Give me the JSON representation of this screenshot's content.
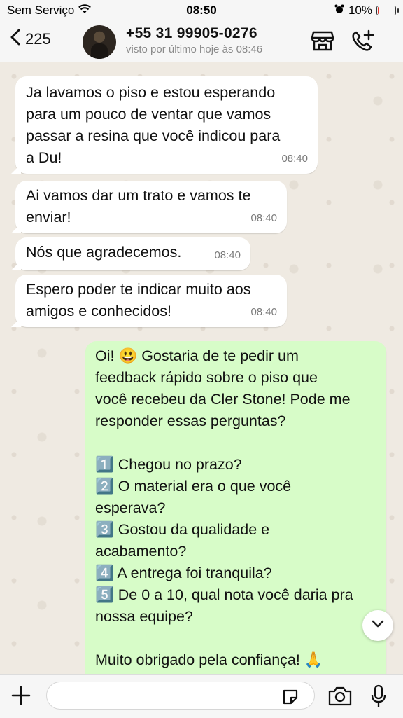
{
  "status_bar": {
    "carrier": "Sem Serviço",
    "time": "08:50",
    "battery": "10%",
    "battery_level": 0.1,
    "icons": [
      "wifi-icon",
      "alarm-icon",
      "battery-icon"
    ]
  },
  "header": {
    "back_count": "225",
    "contact_name": "+55 31 99905-0276",
    "last_seen": "visto por último hoje às 08:46",
    "icons": [
      "chevron-left-icon",
      "store-icon",
      "add-call-icon"
    ]
  },
  "messages": [
    {
      "direction": "in",
      "text": "Ja lavamos o piso e estou esperando\npara um pouco de ventar que vamos\npassar a resina que você indicou para\na Du!",
      "time": "08:40"
    },
    {
      "direction": "in",
      "text": "Ai vamos dar um trato e vamos te\nenviar!",
      "time": "08:40"
    },
    {
      "direction": "in",
      "text": "Nós que agradecemos.",
      "time": "08:40"
    },
    {
      "direction": "in",
      "text": "Espero poder te indicar muito aos\namigos e conhecidos!",
      "time": "08:40"
    },
    {
      "direction": "out",
      "text": "Oi! 😃 Gostaria de te pedir um\nfeedback rápido sobre o piso que\nvocê recebeu da Cler Stone! Pode me\nresponder essas perguntas?\n\n1️⃣ Chegou no prazo?\n2️⃣ O material era o que você\nesperava?\n3️⃣ Gostou da qualidade e\nacabamento?\n4️⃣ A entrega foi tranquila?\n5️⃣ De 0 a 10, qual nota você daria pra\nnossa equipe?\n\nMuito obrigado pela confiança! 🙏"
    }
  ],
  "input": {
    "placeholder": "",
    "icons": [
      "plus-icon",
      "sticker-icon",
      "camera-icon",
      "microphone-icon"
    ]
  },
  "colors": {
    "incoming_bubble": "#ffffff",
    "outgoing_bubble": "#d7fcc8",
    "chat_background": "#efeae2",
    "bar_background": "#f6f6f6",
    "battery_low": "#e0332b"
  }
}
